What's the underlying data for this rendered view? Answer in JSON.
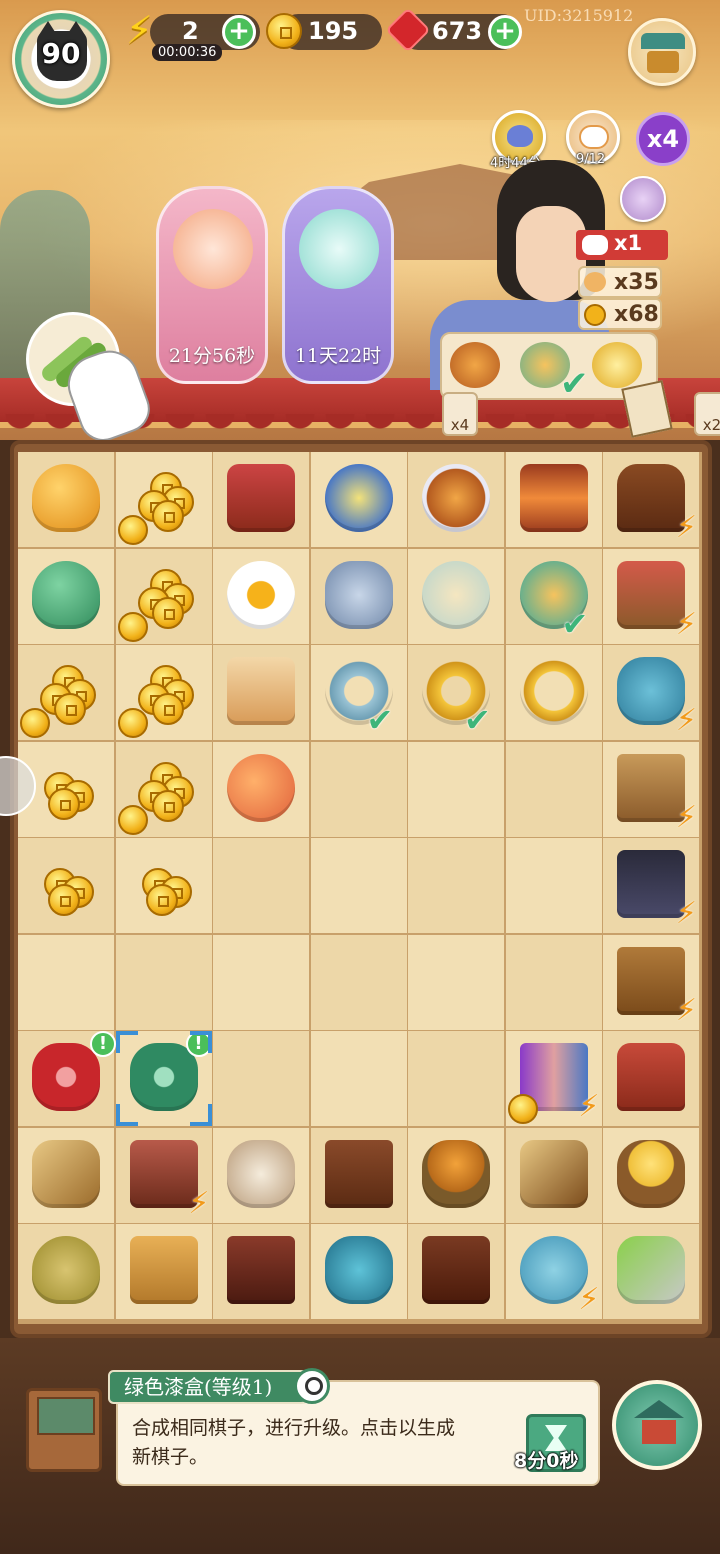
{
  "top_bar": {
    "level": "90",
    "energy": "2",
    "energy_timer": "00:00:36",
    "coins": "195",
    "gems": "673",
    "uid": "UID:3215912",
    "plus": "+"
  },
  "boosts": {
    "potion_timer": "4时44分",
    "cat_progress": "9/12",
    "multiplier": "x4"
  },
  "pet_cards": [
    {
      "timer": "21分56秒"
    },
    {
      "timer": "11天22时"
    }
  ],
  "order": {
    "cat_count": "x1",
    "reward_a": "x35",
    "reward_b": "x68",
    "tag_left": "x4",
    "tag_right": "x2"
  },
  "board": {
    "rows": [
      [
        "gold-gourd",
        "coin-pile-large",
        "flower-lantern",
        "tea-bowl",
        "roast-chicken-bowl",
        "palace-lantern",
        "tree-generator"
      ],
      [
        "green-gourd",
        "coin-pile-large",
        "fried-egg",
        "cloud-pendant",
        "rice-soup",
        "dessert-bowl",
        "food-basket"
      ],
      [
        "coin-pile-large",
        "coin-pile-large",
        "paper-lantern",
        "jade-ring",
        "gold-ring",
        "gold-bracelet",
        "teapot-stand"
      ],
      [
        "coin-pile-small",
        "coin-pile-large",
        "red-lantern",
        "",
        "",
        "",
        "scroll-shelf"
      ],
      [
        "coin-pile-small",
        "coin-pile-small",
        "",
        "",
        "",
        "",
        "jewelry-chest"
      ],
      [
        "",
        "",
        "",
        "",
        "",
        "",
        "loom"
      ],
      [
        "red-lacquer-box",
        "green-lacquer-box",
        "",
        "",
        "",
        "book-set",
        "chicken-coop"
      ],
      [
        "bamboo-brushes",
        "treasure-chest",
        "silk-spools",
        "wooden-box",
        "hen-nest",
        "ruler-brush",
        "chick-nest"
      ],
      [
        "woven-basket",
        "tool-box",
        "brown-box",
        "jade-jar",
        "locked-chest",
        "blue-teapot",
        "garden-shears"
      ]
    ]
  },
  "info_panel": {
    "title": "绿色漆盒(等级1)",
    "description": "合成相同棋子，进行升级。点击以生成新棋子。",
    "speedup_time": "8分0秒"
  },
  "colors": {
    "accent_green": "#4bbf5a",
    "coin_gold": "#f2b21a",
    "gem_red": "#d3262b",
    "check_green": "#3db57a",
    "bolt_orange": "#f29a1a"
  }
}
